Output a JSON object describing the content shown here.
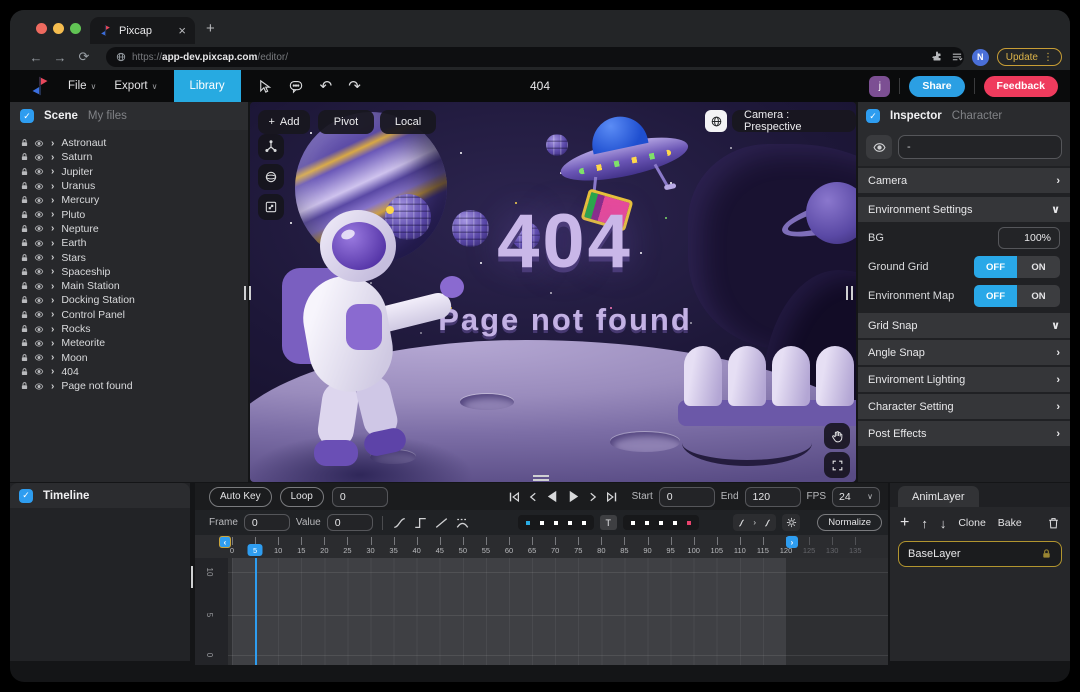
{
  "browser": {
    "tab_title": "Pixcap",
    "url_scheme": "https://",
    "url_host": "app-dev.pixcap.com",
    "url_path": "/editor/",
    "profile_initial": "N",
    "update_label": "Update"
  },
  "app_toolbar": {
    "file": "File",
    "export": "Export",
    "library": "Library",
    "doc_title": "404",
    "avatar_initial": "j",
    "share": "Share",
    "feedback": "Feedback"
  },
  "scene_panel": {
    "tab_scene": "Scene",
    "tab_myfiles": "My files",
    "items": [
      "Astronaut",
      "Saturn",
      "Jupiter",
      "Uranus",
      "Mercury",
      "Pluto",
      "Nepture",
      "Earth",
      "Stars",
      "Spaceship",
      "Main Station",
      "Docking Station",
      "Control Panel",
      "Rocks",
      "Meteorite",
      "Moon",
      "404",
      "Page not found"
    ]
  },
  "viewport": {
    "add": "Add",
    "pivot": "Pivot",
    "local": "Local",
    "camera_label": "Camera : Prespective",
    "title": "404",
    "subtitle": "Page not found"
  },
  "inspector": {
    "tab_inspector": "Inspector",
    "tab_character": "Character",
    "selection_value": "-",
    "camera_section": "Camera",
    "env_settings": "Environment Settings",
    "bg_label": "BG",
    "bg_value": "100%",
    "ground_grid": "Ground Grid",
    "env_map": "Environment Map",
    "off": "OFF",
    "on": "ON",
    "sections": [
      {
        "label": "Grid Snap",
        "expanded": true
      },
      {
        "label": "Angle Snap",
        "expanded": false
      },
      {
        "label": "Enviroment Lighting",
        "expanded": false
      },
      {
        "label": "Character Setting",
        "expanded": false
      },
      {
        "label": "Post Effects",
        "expanded": false
      }
    ]
  },
  "timeline": {
    "tab": "Timeline",
    "auto_key": "Auto Key",
    "loop": "Loop",
    "loop_value": "0",
    "start_label": "Start",
    "start_value": "0",
    "end_label": "End",
    "end_value": "120",
    "fps_label": "FPS",
    "fps_value": "24",
    "frame_label": "Frame",
    "frame_value": "0",
    "value_label": "Value",
    "value_value": "0",
    "t_button": "T",
    "normalize": "Normalize",
    "ticks": [
      0,
      5,
      10,
      15,
      20,
      25,
      30,
      35,
      40,
      45,
      50,
      55,
      60,
      65,
      70,
      75,
      80,
      85,
      90,
      95,
      100,
      105,
      110,
      115,
      120,
      125,
      130,
      135
    ],
    "active_start": 0,
    "active_end": 120,
    "playhead": 5,
    "value_axis": [
      "10",
      "5",
      "0"
    ],
    "left_dots": [
      "#29abe2",
      "#ffffff",
      "#ffffff",
      "#ffffff",
      "#ffffff"
    ],
    "right_dots": [
      "#ffffff",
      "#ffffff",
      "#ffffff",
      "#ffffff",
      "#e8436d"
    ]
  },
  "anim_layer": {
    "tab": "AnimLayer",
    "clone": "Clone",
    "bake": "Bake",
    "layer_name": "BaseLayer"
  },
  "icons": {
    "check": "✓",
    "chevron_down": "∨",
    "chevron_right": "›",
    "chevron_left": "‹",
    "close": "×",
    "plus": "+",
    "back": "←",
    "forward": "→",
    "reload": "⟳",
    "undo": "↶",
    "redo": "↷",
    "menu_dots": "⋮",
    "up_arrow": "↑",
    "down_arrow": "↓"
  }
}
